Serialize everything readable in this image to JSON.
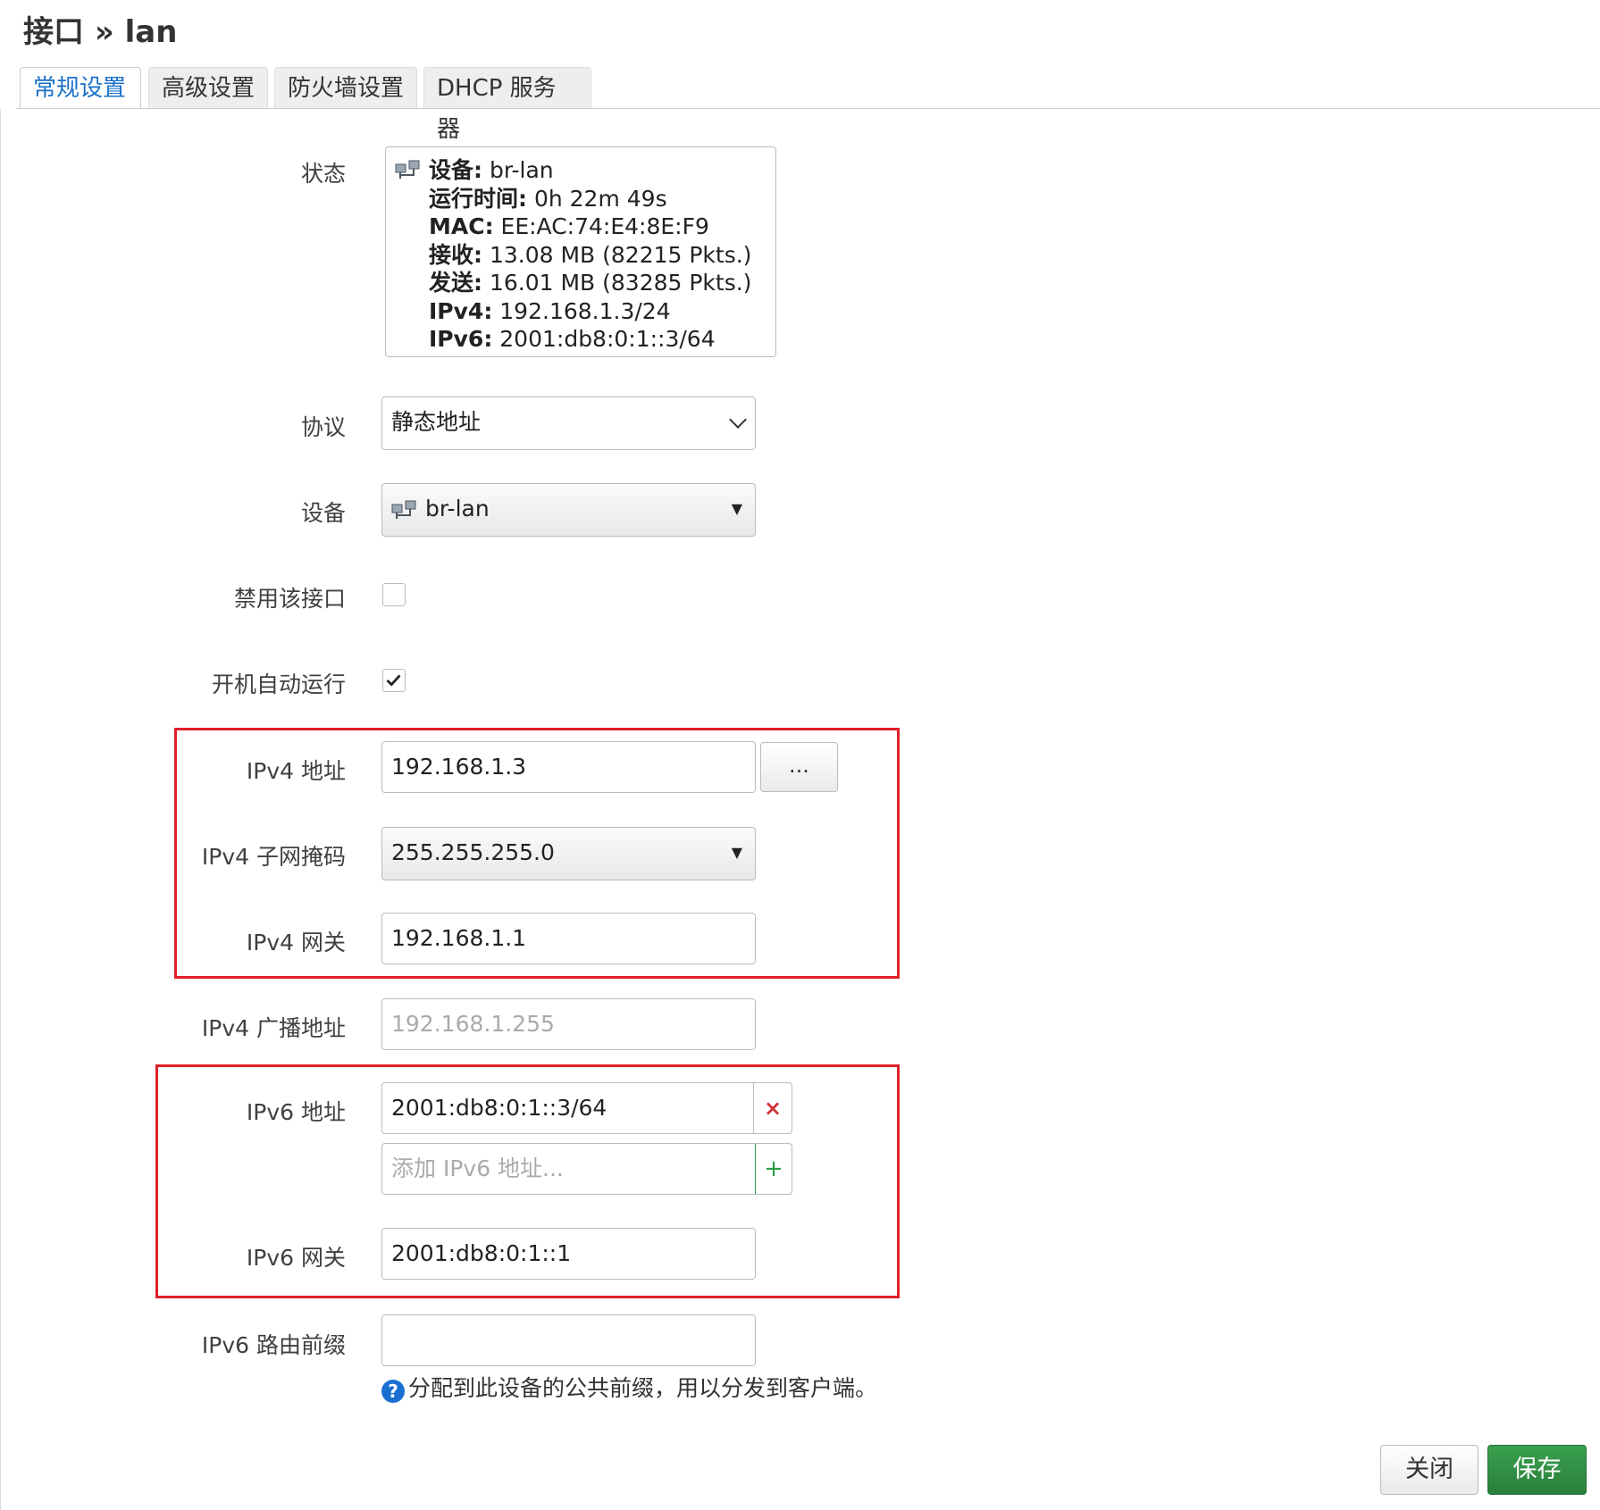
{
  "page": {
    "title": "接口 » lan"
  },
  "tabs": [
    {
      "label": "常规设置",
      "active": true
    },
    {
      "label": "高级设置",
      "active": false
    },
    {
      "label": "防火墙设置",
      "active": false
    },
    {
      "label": "DHCP 服务器",
      "active": false
    }
  ],
  "form": {
    "status": {
      "label": "状态",
      "device_key": "设备:",
      "device_val": " br-lan",
      "uptime_key": "运行时间:",
      "uptime_val": " 0h 22m 49s",
      "mac_key": "MAC:",
      "mac_val": " EE:AC:74:E4:8E:F9",
      "rx_key": "接收:",
      "rx_val": " 13.08 MB (82215 Pkts.)",
      "tx_key": "发送:",
      "tx_val": " 16.01 MB (83285 Pkts.)",
      "ipv4_key": "IPv4:",
      "ipv4_val": " 192.168.1.3/24",
      "ipv6_key": "IPv6:",
      "ipv6_val": " 2001:db8:0:1::3/64"
    },
    "protocol": {
      "label": "协议",
      "value": "静态地址"
    },
    "device": {
      "label": "设备",
      "value": "br-lan"
    },
    "disable": {
      "label": "禁用该接口",
      "checked": false
    },
    "autostart": {
      "label": "开机自动运行",
      "checked": true
    },
    "ipv4_addr": {
      "label": "IPv4 地址",
      "value": "192.168.1.3",
      "more_label": "..."
    },
    "ipv4_mask": {
      "label": "IPv4 子网掩码",
      "value": "255.255.255.0"
    },
    "ipv4_gw": {
      "label": "IPv4 网关",
      "value": "192.168.1.1"
    },
    "ipv4_bcast": {
      "label": "IPv4 广播地址",
      "placeholder": "192.168.1.255"
    },
    "ipv6_addr": {
      "label": "IPv6 地址",
      "value": "2001:db8:0:1::3/64",
      "remove_label": "×",
      "placeholder": "添加 IPv6 地址...",
      "add_label": "+"
    },
    "ipv6_gw": {
      "label": "IPv6 网关",
      "value": "2001:db8:0:1::1"
    },
    "ipv6_prefix": {
      "label": "IPv6 路由前缀",
      "value": "",
      "help": "分配到此设备的公共前缀，用以分发到客户端。"
    }
  },
  "footer": {
    "close_label": "关闭",
    "save_label": "保存"
  },
  "colors": {
    "accent": "#1a73c8",
    "highlight": "#e0202a",
    "save": "#2e8b3f"
  },
  "icons": [
    "network-device-icon",
    "chevron-down-icon",
    "caret-down-icon",
    "checkmark-icon",
    "remove-icon",
    "add-icon",
    "help-icon"
  ]
}
